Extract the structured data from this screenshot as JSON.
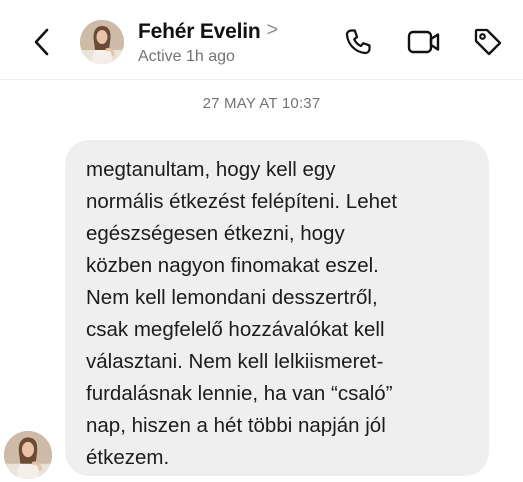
{
  "header": {
    "contact_name": "Fehér Evelin",
    "chevron": ">",
    "status": "Active 1h ago",
    "icons": {
      "back": "chevron-left-icon",
      "phone": "phone-icon",
      "video": "video-camera-icon",
      "tag": "tag-icon"
    }
  },
  "chat": {
    "timestamp": "27 MAY AT 10:37",
    "message": "megtanultam, hogy kell egy\nnormális étkezést felépíteni. Lehet\negészségesen étkezni, hogy\nközben nagyon finomakat eszel.\nNem kell lemondani desszertről,\ncsak megfelelő hozzávalókat kell\nválasztani. Nem kell lelkiismeret-\nfurdalásnak lennie, ha van “csaló”\nnap, hiszen a hét többi napján jól\nétkezem."
  },
  "colors": {
    "background": "#ffffff",
    "bubble": "#efefef",
    "secondary_text": "#737373",
    "primary_text": "#111111"
  }
}
